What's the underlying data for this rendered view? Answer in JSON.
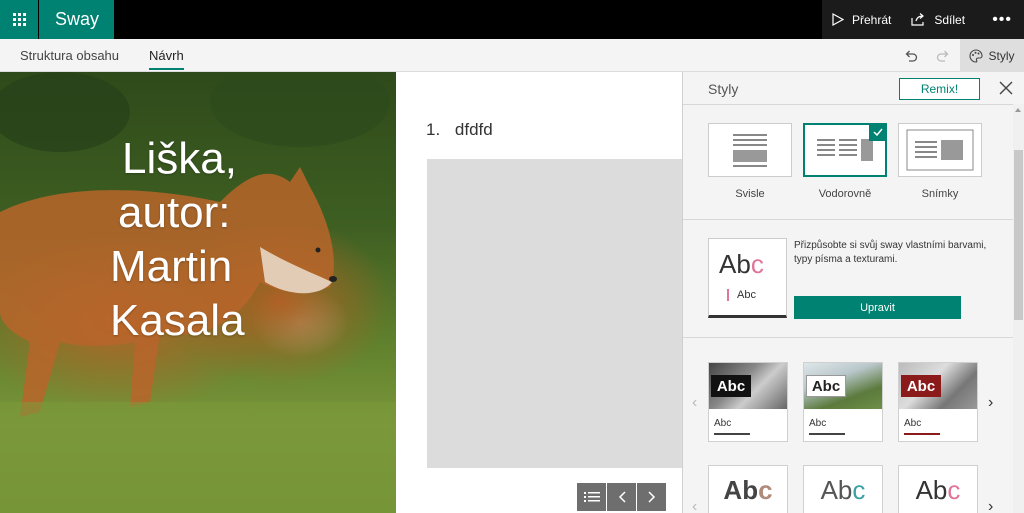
{
  "app": {
    "name": "Sway"
  },
  "topbar": {
    "play_label": "Přehrát",
    "share_label": "Sdílet",
    "more": "•••"
  },
  "tabs": [
    {
      "label": "Struktura obsahu"
    },
    {
      "label": "Návrh",
      "active": true
    }
  ],
  "toolbar": {
    "styles_label": "Styly"
  },
  "hero": {
    "title_lines": [
      "Liška,",
      "autor:",
      "Martin",
      "Kasala"
    ]
  },
  "content": {
    "list_number": "1.",
    "list_text": "dfdfd"
  },
  "panel": {
    "title": "Styly",
    "remix_label": "Remix!",
    "layouts": [
      {
        "label": "Svisle"
      },
      {
        "label": "Vodorovně",
        "selected": true
      },
      {
        "label": "Snímky"
      }
    ],
    "customize": {
      "sample_big": "Abc",
      "sample_small": "Abc",
      "text": "Přizpůsobte si svůj sway vlastními barvami, typy písma a texturami.",
      "edit_label": "Upravit"
    },
    "themes_row1": [
      {
        "tag": "Abc",
        "sub": "Abc",
        "tag_bg": "#111111",
        "tag_color": "#ffffff",
        "rule": "#444444"
      },
      {
        "tag": "Abc",
        "sub": "Abc",
        "tag_bg": "#ffffff",
        "tag_color": "#222222",
        "rule": "#444444"
      },
      {
        "tag": "Abc",
        "sub": "Abc",
        "tag_bg": "#8b1a1a",
        "tag_color": "#ffffff",
        "rule": "#8b1a1a"
      }
    ],
    "themes_row2": [
      {
        "text": "Abc",
        "color": "#444444",
        "accent": "#b08a7a"
      },
      {
        "text": "Abc",
        "color": "#555555",
        "accent": "#3aa0a6"
      },
      {
        "text": "Abc",
        "color": "#333333",
        "accent": "#e0749a"
      }
    ]
  },
  "colors": {
    "accent": "#008272"
  }
}
